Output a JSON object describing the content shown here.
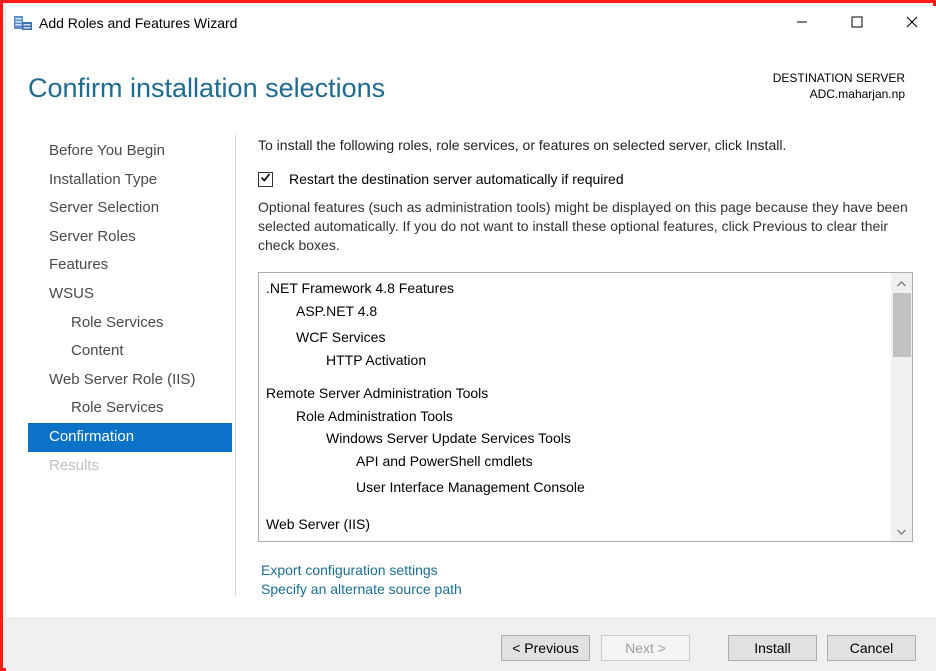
{
  "window": {
    "title": "Add Roles and Features Wizard",
    "icon": "server-manager-icon",
    "controls": [
      "minimize-icon",
      "maximize-icon",
      "close-icon"
    ]
  },
  "header": {
    "page_title": "Confirm installation selections",
    "destination_label": "DESTINATION SERVER",
    "destination_server": "ADC.maharjan.np"
  },
  "nav": {
    "items": [
      {
        "label": "Before You Begin",
        "state": "normal"
      },
      {
        "label": "Installation Type",
        "state": "normal"
      },
      {
        "label": "Server Selection",
        "state": "normal"
      },
      {
        "label": "Server Roles",
        "state": "normal"
      },
      {
        "label": "Features",
        "state": "normal"
      },
      {
        "label": "WSUS",
        "state": "normal"
      },
      {
        "label": "Role Services",
        "state": "sub"
      },
      {
        "label": "Content",
        "state": "sub"
      },
      {
        "label": "Web Server Role (IIS)",
        "state": "normal"
      },
      {
        "label": "Role Services",
        "state": "sub"
      },
      {
        "label": "Confirmation",
        "state": "active"
      },
      {
        "label": "Results",
        "state": "disabled"
      }
    ]
  },
  "content": {
    "intro": "To install the following roles, role services, or features on selected server, click Install.",
    "restart_label": "Restart the destination server automatically if required",
    "restart_checked": true,
    "optional_text": "Optional features (such as administration tools) might be displayed on this page because they have been selected automatically. If you do not want to install these optional features, click Previous to clear their check boxes.",
    "features": [
      ".NET Framework 4.8 Features",
      "ASP.NET 4.8",
      "WCF Services",
      "HTTP Activation",
      "Remote Server Administration Tools",
      "Role Administration Tools",
      "Windows Server Update Services Tools",
      "API and PowerShell cmdlets",
      "User Interface Management Console",
      "Web Server (IIS)"
    ],
    "links": {
      "export": "Export configuration settings",
      "alternate_source": "Specify an alternate source path"
    }
  },
  "footer": {
    "previous": "< Previous",
    "next": "Next >",
    "install": "Install",
    "cancel": "Cancel"
  },
  "colors": {
    "accent": "#0a73c7",
    "title": "#1e6b8f",
    "link": "#1a6e91",
    "border": "#ff1a1a"
  }
}
